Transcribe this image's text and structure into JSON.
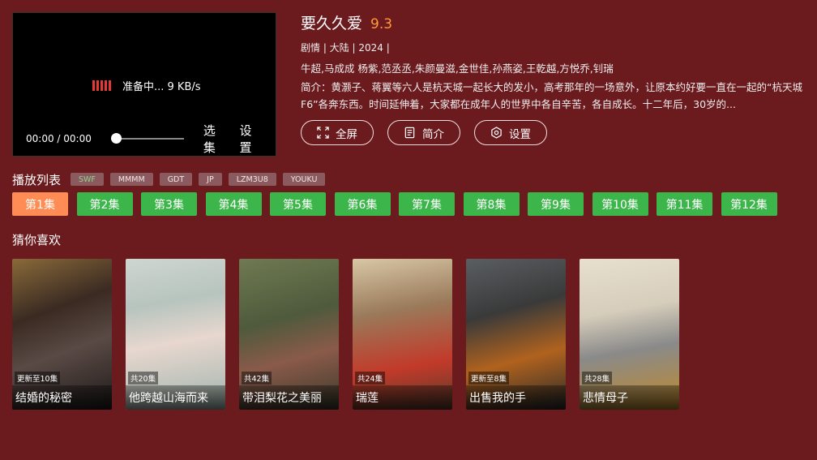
{
  "player": {
    "loading_text": "准备中... 9 KB/s",
    "time": "00:00 / 00:00",
    "episodes_btn": "选集",
    "settings_btn": "设置"
  },
  "info": {
    "title": "要久久爱",
    "score": "9.3",
    "meta": "剧情 | 大陆 | 2024 |",
    "cast": "牛超,马成成   杨紫,范丞丞,朱颜曼滋,金世佳,孙燕姿,王乾越,方悦乔,钊瑞",
    "desc": "简介：黄灏子、蒋翼等六人是杭天城一起长大的发小，高考那年的一场意外，让原本约好要一直在一起的“杭天城F6”各奔东西。时间延伸着，大家都在成年人的世界中各自辛苦，各自成长。十二年后，30岁的...",
    "actions": {
      "fullscreen": "全屏",
      "intro": "简介",
      "settings": "设置"
    }
  },
  "playlist": {
    "title": "播放列表",
    "sources": [
      "SWF",
      "MMMM",
      "GDT",
      "JP",
      "LZM3U8",
      "YOUKU"
    ],
    "episodes": [
      "第1集",
      "第2集",
      "第3集",
      "第4集",
      "第5集",
      "第6集",
      "第7集",
      "第8集",
      "第9集",
      "第10集",
      "第11集",
      "第12集"
    ]
  },
  "recommend": {
    "title": "猜你喜欢",
    "items": [
      {
        "name": "结婚的秘密",
        "badge": "更新至10集"
      },
      {
        "name": "他跨越山海而来",
        "badge": "共20集"
      },
      {
        "name": "带泪梨花之美丽",
        "badge": "共42集"
      },
      {
        "name": "瑞莲",
        "badge": "共24集"
      },
      {
        "name": "出售我的手",
        "badge": "更新至8集"
      },
      {
        "name": "悲情母子",
        "badge": "共28集"
      }
    ]
  },
  "colors": {
    "background": "#6b1a1e",
    "episode_active": "#ff8c55",
    "episode": "#3cb64a",
    "score": "#ff9a3c"
  }
}
